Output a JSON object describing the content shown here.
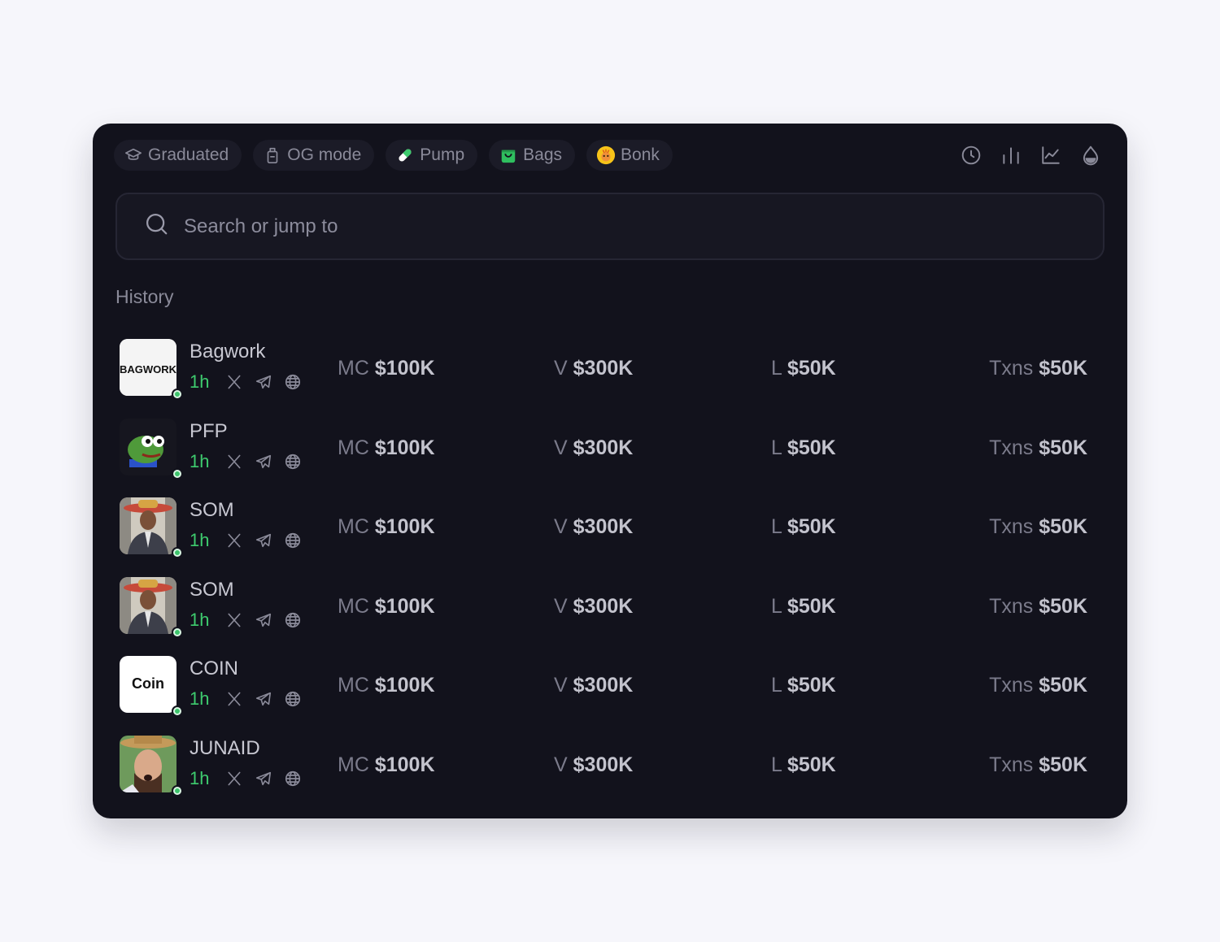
{
  "tabs": [
    {
      "label": "Graduated",
      "icon": "graduation-cap-icon"
    },
    {
      "label": "OG mode",
      "icon": "jar-icon"
    },
    {
      "label": "Pump",
      "icon": "pill-icon"
    },
    {
      "label": "Bags",
      "icon": "bag-icon"
    },
    {
      "label": "Bonk",
      "icon": "bonk-logo-icon"
    }
  ],
  "toolbar_icons": [
    "clock-icon",
    "bar-chart-icon",
    "line-chart-icon",
    "droplet-icon"
  ],
  "search": {
    "placeholder": "Search or jump to"
  },
  "history": {
    "label": "History",
    "stat_labels": {
      "mc": "MC",
      "v": "V",
      "l": "L",
      "txns": "Txns"
    },
    "rows": [
      {
        "name": "Bagwork",
        "avatar": "bagwork",
        "avatar_text": "BAGWORK",
        "age": "1h",
        "mc": "$100K",
        "v": "$300K",
        "l": "$50K",
        "txns": "$50K"
      },
      {
        "name": "PFP",
        "avatar": "frog",
        "age": "1h",
        "mc": "$100K",
        "v": "$300K",
        "l": "$50K",
        "txns": "$50K"
      },
      {
        "name": "SOM",
        "avatar": "man-sombrero",
        "age": "1h",
        "mc": "$100K",
        "v": "$300K",
        "l": "$50K",
        "txns": "$50K"
      },
      {
        "name": "SOM",
        "avatar": "man-sombrero",
        "age": "1h",
        "mc": "$100K",
        "v": "$300K",
        "l": "$50K",
        "txns": "$50K"
      },
      {
        "name": "COIN",
        "avatar": "coin",
        "avatar_text": "Coin",
        "age": "1h",
        "mc": "$100K",
        "v": "$300K",
        "l": "$50K",
        "txns": "$50K"
      },
      {
        "name": "JUNAID",
        "avatar": "man-hat",
        "age": "1h",
        "mc": "$100K",
        "v": "$300K",
        "l": "$50K",
        "txns": "$50K"
      }
    ]
  },
  "colors": {
    "panel": "#12121c",
    "page": "#f6f6fb",
    "accent_green": "#3ecb6e"
  }
}
